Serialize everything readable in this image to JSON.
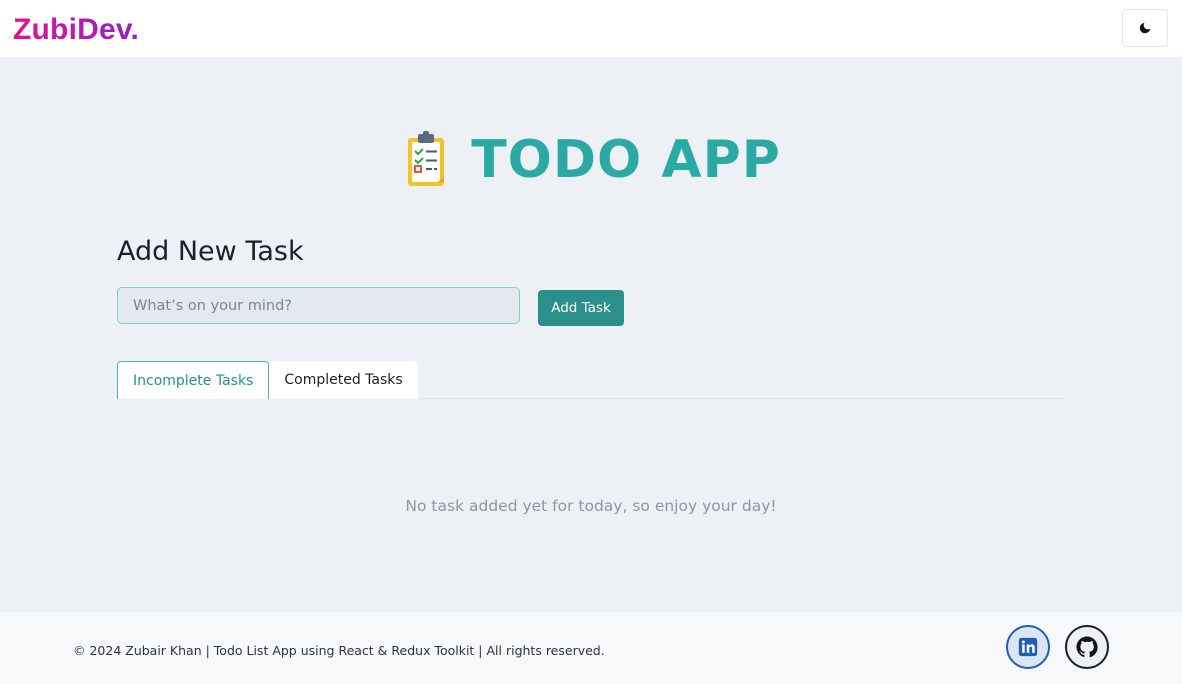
{
  "navbar": {
    "brand": "ZubiDev.",
    "theme_toggle_icon": "moon-icon"
  },
  "hero": {
    "icon": "clipboard-checklist-icon",
    "title": "TODO APP"
  },
  "add_task": {
    "heading": "Add New Task",
    "input_placeholder": "What’s on your mind?",
    "input_value": "",
    "button_label": "Add Task"
  },
  "tabs": [
    {
      "label": "Incomplete Tasks",
      "active": true
    },
    {
      "label": "Completed Tasks",
      "active": false
    }
  ],
  "empty_state": "No task added yet for today, so enjoy your day!",
  "footer": {
    "copyright": "© 2024 Zubair Khan | Todo List App using React & Redux Toolkit | All rights reserved.",
    "social": [
      {
        "name": "linkedin-icon"
      },
      {
        "name": "github-icon"
      }
    ]
  },
  "colors": {
    "brand_gradient_start": "#e0148a",
    "brand_gradient_end": "#8a24c9",
    "accent_teal": "#2aaaa2",
    "button_teal": "#2c8f8a",
    "page_background": "#edf1f5"
  }
}
